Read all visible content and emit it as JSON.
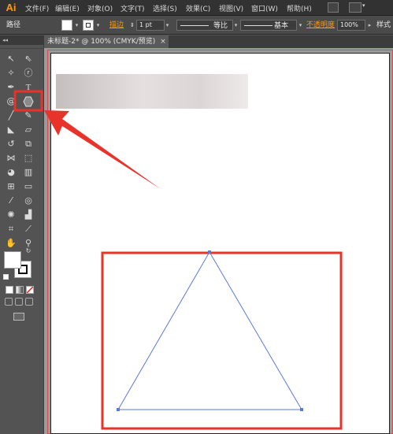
{
  "app": {
    "logo": "Ai"
  },
  "menu": {
    "items": [
      "文件(F)",
      "编辑(E)",
      "对象(O)",
      "文字(T)",
      "选择(S)",
      "效果(C)",
      "视图(V)",
      "窗口(W)",
      "帮助(H)"
    ]
  },
  "control_bar": {
    "object_type": "路径",
    "stroke_label": "描边",
    "stroke_weight": "1 pt",
    "profile_label": "等比",
    "brush_label": "基本",
    "opacity_label": "不透明度",
    "opacity_value": "100%",
    "style_label": "样式",
    "colors": {
      "link": "#ff9900"
    }
  },
  "document": {
    "tab_title": "未标题-2* @ 100% (CMYK/预览)",
    "close_glyph": "×"
  },
  "toolbox": {
    "collapse_glyph": "◂◂",
    "tools": [
      "selection-tool",
      "direct-selection-tool",
      "magic-wand-tool",
      "lasso-tool",
      "pen-tool",
      "type-tool",
      "spiral-tool",
      "polygon-tool",
      "paintbrush-tool",
      "pencil-tool",
      "blob-brush-tool",
      "eraser-tool",
      "rotate-tool",
      "scale-tool",
      "width-tool",
      "free-transform-tool",
      "shape-builder-tool",
      "perspective-grid-tool",
      "mesh-tool",
      "gradient-tool",
      "eyedropper-tool",
      "blend-tool",
      "symbol-sprayer-tool",
      "column-graph-tool",
      "artboard-tool",
      "slice-tool",
      "hand-tool",
      "zoom-tool"
    ],
    "highlighted_tool": "polygon-tool"
  },
  "annotation": {
    "color": "#e8332b"
  },
  "shapes": {
    "triangle_stroke": "#5b7ad6"
  }
}
